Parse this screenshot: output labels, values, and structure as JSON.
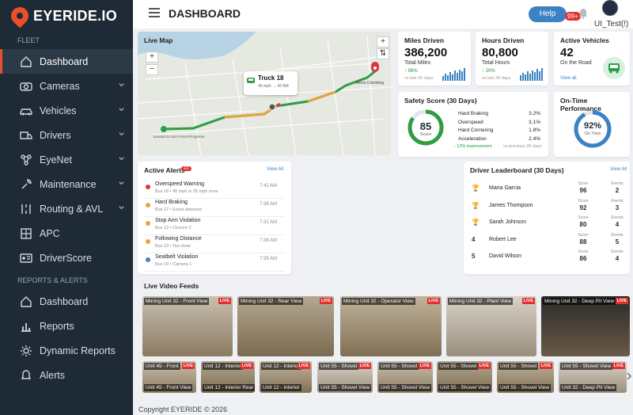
{
  "app": {
    "logo": "EYERIDE.IO"
  },
  "sidebar": {
    "fleet_label": "FLEET",
    "reports_label": "REPORTS & ALERTS",
    "fleet_items": [
      {
        "label": "Dashboard",
        "icon": "home-icon",
        "active": true
      },
      {
        "label": "Cameras",
        "icon": "camera-icon",
        "chevron": true
      },
      {
        "label": "Vehicles",
        "icon": "car-icon",
        "chevron": true
      },
      {
        "label": "Drivers",
        "icon": "truck-icon",
        "chevron": true
      },
      {
        "label": "EyeNet",
        "icon": "network-icon",
        "chevron": true
      },
      {
        "label": "Maintenance",
        "icon": "wrench-icon",
        "chevron": true
      },
      {
        "label": "Routing & AVL",
        "icon": "route-icon",
        "chevron": true
      },
      {
        "label": "APC",
        "icon": "grid-icon"
      },
      {
        "label": "DriverScore",
        "icon": "id-card-icon"
      }
    ],
    "report_items": [
      {
        "label": "Dashboard",
        "icon": "home-icon"
      },
      {
        "label": "Reports",
        "icon": "bar-chart-icon"
      },
      {
        "label": "Dynamic Reports",
        "icon": "gear-icon"
      },
      {
        "label": "Alerts",
        "icon": "bell-icon"
      }
    ]
  },
  "topbar": {
    "title": "DASHBOARD",
    "help": "Help",
    "notifications": "99+",
    "user": "UI_Test(!)"
  },
  "map": {
    "title": "Live Map",
    "zoom_in": "+",
    "zoom_out": "−",
    "truck_label": "Truck 18",
    "truck_sub": "45 mph → 42 AM",
    "dest_label": "Mono Clombing",
    "origin_label": "Existriel to Sun Forcel Progrems"
  },
  "kpis": [
    {
      "title": "Miles Driven",
      "value": "386,200",
      "sub": "Total Miles",
      "change": "↑ 98%",
      "vs": "vs last 30 days"
    },
    {
      "title": "Hours Driven",
      "value": "80,800",
      "sub": "Total Hours",
      "change": "↑ 20%",
      "vs": "vs last 30 days"
    },
    {
      "title": "Active Vehicles",
      "value": "42",
      "sub": "On the Road",
      "link": "View all"
    }
  ],
  "safety": {
    "title": "Safety Score (30 Days)",
    "score": "85",
    "score_label": "Score",
    "score_fraction": 0.85,
    "items": [
      {
        "label": "Hard Braking",
        "value": "3.2%"
      },
      {
        "label": "Overspeed",
        "value": "3.1%"
      },
      {
        "label": "Hard Cornering",
        "value": "1.8%"
      },
      {
        "label": "Acceleration",
        "value": "2.4%"
      }
    ],
    "improvement": "↑ 12% improvement",
    "vs": "vs previous 30 days"
  },
  "ontime": {
    "title": "On-Time Performance",
    "value": "92%",
    "label": "On Time",
    "fraction": 0.92
  },
  "alerts": {
    "title": "Active Alerts",
    "count": "22",
    "link": "View All",
    "items": [
      {
        "label": "Overspeed Warning",
        "sub": "Bus 18 • 45 mph in 35 mph zone",
        "time": "7:42 AM",
        "color": "#d63b3b"
      },
      {
        "label": "Hard Braking",
        "sub": "Bus 27 • Event detected",
        "time": "7:38 AM",
        "color": "#e8a33a"
      },
      {
        "label": "Stop Arm Violation",
        "sub": "Bus 12 • Closure 2",
        "time": "7:31 AM",
        "color": "#e8a33a"
      },
      {
        "label": "Following Distance",
        "sub": "Bus 23 • Too close",
        "time": "7:38 AM",
        "color": "#e8a33a"
      },
      {
        "label": "Seatbelt Violation",
        "sub": "Bus 19 • Camera 1",
        "time": "7:39 AM",
        "color": "#3b82c4"
      }
    ]
  },
  "leaderboard": {
    "title": "Driver Leaderboard (30 Days)",
    "link": "View All",
    "score_label": "Score",
    "events_label": "Events",
    "drivers": [
      {
        "rank": "🏆",
        "name": "Maria Garcia",
        "score": "96",
        "events": "2",
        "rank_color": "#d4a017"
      },
      {
        "rank": "🏆",
        "name": "James Thompson",
        "score": "92",
        "events": "3",
        "rank_color": "#9aa3ad"
      },
      {
        "rank": "🏆",
        "name": "Sarah Johnson",
        "score": "80",
        "events": "4",
        "rank_color": "#c87533"
      },
      {
        "rank": "4",
        "name": "Robert Lee",
        "score": "88",
        "events": "5",
        "rank_color": "#333"
      },
      {
        "rank": "5",
        "name": "David Wilson",
        "score": "86",
        "events": "4",
        "rank_color": "#333"
      }
    ]
  },
  "video": {
    "title": "Live Video Feeds",
    "live": "LIVE",
    "main_feeds": [
      "Mining Unit 32 - Front View",
      "Mining Unit 32 - Rear View",
      "Mining Unit 32 - Operator View",
      "Mining Unit 32 - Plant View",
      "Mining Unit 32 - Deep Pit View"
    ],
    "small_feeds": [
      {
        "top": "Unit 45 - Front",
        "bottom": "Unit 45 - Front View"
      },
      {
        "top": "Unit 12 - Interior",
        "bottom": "Unit 12 - Interior Rear"
      },
      {
        "top": "Unit 12 - Interior",
        "bottom": "Unit 12 - Interior"
      },
      {
        "top": "Unit 55 - Shovel",
        "bottom": "Unit 55 - Shovel View"
      },
      {
        "top": "Unit 55 - Shovel",
        "bottom": "Unit 55 - Shovel View"
      },
      {
        "top": "Unit 55 - Shovel",
        "bottom": "Unit 55 - Shovel View"
      },
      {
        "top": "Unit 55 - Shovel",
        "bottom": "Unit 55 - Shovel View"
      },
      {
        "top": "Unit 55 - Shovel View",
        "bottom": "Unit 32 - Deep Pit View"
      }
    ]
  },
  "footer": "Copyright EYERIDE © 2026"
}
